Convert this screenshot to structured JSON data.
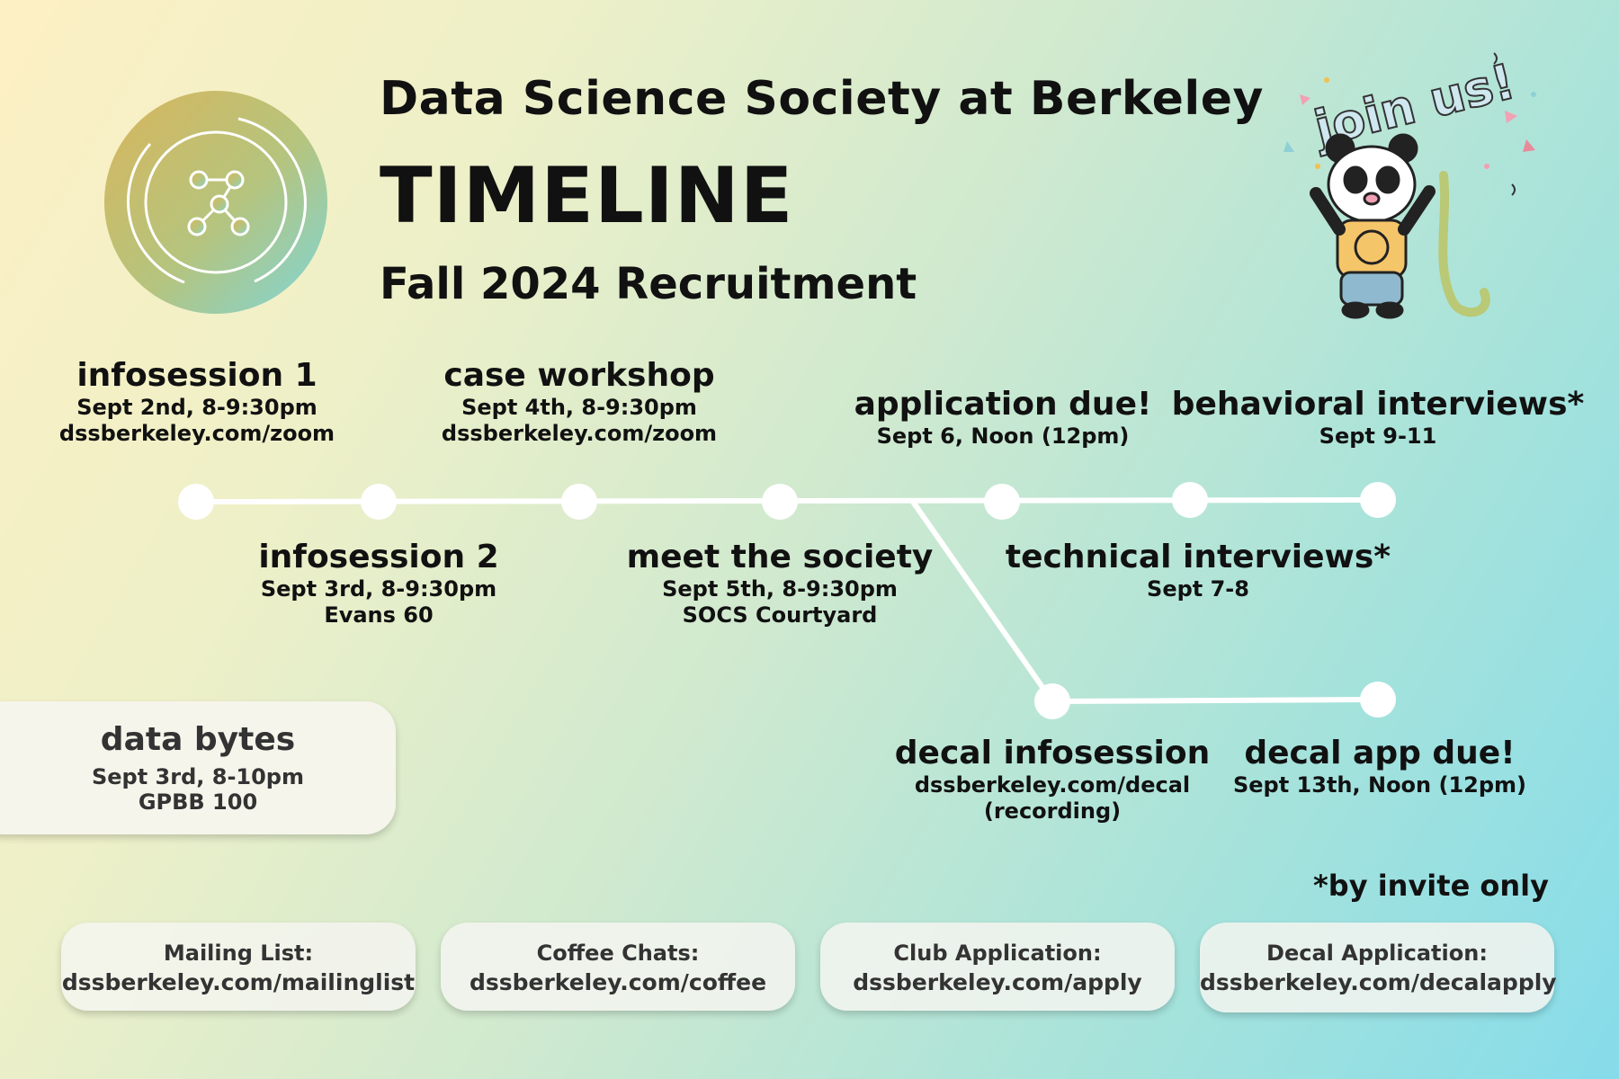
{
  "header": {
    "org_title": "Data Science Society at Berkeley",
    "timeline_title": "TIMELINE",
    "subtitle": "Fall 2024 Recruitment"
  },
  "sticker": {
    "text": "join us!"
  },
  "events": {
    "infosession1": {
      "name": "infosession 1",
      "line1": "Sept 2nd, 8-9:30pm",
      "line2": "dssberkeley.com/zoom"
    },
    "infosession2": {
      "name": "infosession 2",
      "line1": "Sept 3rd, 8-9:30pm",
      "line2": "Evans 60"
    },
    "case_workshop": {
      "name": "case workshop",
      "line1": "Sept 4th, 8-9:30pm",
      "line2": "dssberkeley.com/zoom"
    },
    "meet_society": {
      "name": "meet the society",
      "line1": "Sept 5th, 8-9:30pm",
      "line2": "SOCS Courtyard"
    },
    "application_due": {
      "name": "application due!",
      "line1": "Sept 6, Noon (12pm)"
    },
    "technical": {
      "name": "technical interviews*",
      "line1": "Sept 7-8"
    },
    "behavioral": {
      "name": "behavioral interviews*",
      "line1": "Sept 9-11"
    },
    "decal_info": {
      "name": "decal infosession",
      "line1": "dssberkeley.com/decal",
      "line2": "(recording)"
    },
    "decal_due": {
      "name": "decal app due!",
      "line1": "Sept 13th, Noon (12pm)"
    }
  },
  "data_bytes": {
    "name": "data bytes",
    "line1": "Sept 3rd, 8-10pm",
    "line2": "GPBB 100"
  },
  "note": "*by invite only",
  "links": [
    {
      "label": "Mailing List:",
      "url": "dssberkeley.com/mailinglist"
    },
    {
      "label": "Coffee Chats:",
      "url": "dssberkeley.com/coffee"
    },
    {
      "label": "Club Application:",
      "url": "dssberkeley.com/apply"
    },
    {
      "label": "Decal Application:",
      "url": "dssberkeley.com/decalapply"
    }
  ],
  "colors": {
    "text": "#111111",
    "line": "#ffffff",
    "muted_text": "#333333"
  }
}
